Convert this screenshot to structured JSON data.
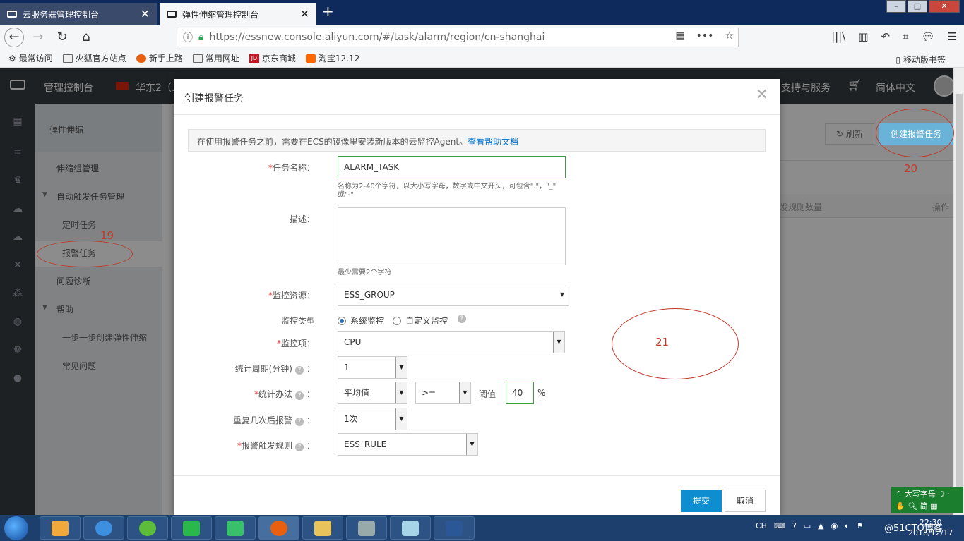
{
  "browser": {
    "tabs": [
      {
        "label": "云服务器管理控制台",
        "active": false
      },
      {
        "label": "弹性伸缩管理控制台",
        "active": true
      }
    ],
    "url": "https://essnew.console.aliyun.com/#/task/alarm/region/cn-shanghai",
    "bookmarks": [
      "最常访问",
      "火狐官方站点",
      "新手上路",
      "常用网址",
      "京东商城",
      "淘宝12.12"
    ],
    "mobile_bookmarks": "移动版书签"
  },
  "console": {
    "home": "管理控制台",
    "region": "华东2（...",
    "support": "支持与服务",
    "language": "简体中文"
  },
  "sidebar": {
    "title": "弹性伸缩",
    "items": {
      "group_mgmt": "伸缩组管理",
      "auto_tasks": "自动触发任务管理",
      "scheduled": "定时任务",
      "alarm": "报警任务",
      "diagnosis": "问题诊断",
      "help": "帮助",
      "step_by_step": "一步一步创建弹性伸缩",
      "faq": "常见问题"
    }
  },
  "main": {
    "refresh": "刷新",
    "create": "创建报警任务",
    "col_rules": "发规则数量",
    "col_ops": "操作"
  },
  "modal": {
    "title": "创建报警任务",
    "notice_text": "在使用报警任务之前，需要在ECS的镜像里安装新版本的云监控Agent。",
    "notice_link": "查看帮助文档",
    "task_name_label": "任务名称：",
    "task_name_value": "ALARM_TASK",
    "task_name_hint1": "名称为2-40个字符，以大小写字母，数字或中文开头，可包含\".\"，\"_\"",
    "task_name_hint2": "或\"-\"",
    "desc_label": "描述：",
    "desc_hint": "最少需要2个字符",
    "resource_label": "监控资源：",
    "resource_value": "ESS_GROUP",
    "type_label": "监控类型",
    "type_system": "系统监控",
    "type_custom": "自定义监控",
    "metric_label": "监控项：",
    "metric_value": "CPU",
    "period_label": "统计周期(分钟)",
    "period_value": "1",
    "method_label": "统计办法",
    "method_value": "平均值",
    "operator_value": ">=",
    "threshold_label": "阈值",
    "threshold_value": "40",
    "threshold_unit": "%",
    "repeat_label": "重复几次后报警",
    "repeat_value": "1次",
    "rule_label": "报警触发规则",
    "rule_value": "ESS_RULE",
    "submit": "提交",
    "cancel": "取消",
    "colon": "："
  },
  "annotations": {
    "n19": "19",
    "n20": "20",
    "n21": "21"
  },
  "taskbar": {
    "lang": "CH",
    "time": "22:30",
    "date": "2018/12/17"
  },
  "ime": {
    "line1": "大写字母",
    "line2": "简"
  },
  "watermark": "@51CTO博客",
  "colors": {
    "accent": "#0e8ed1",
    "required": "#e4393c",
    "annotation": "#c0392b",
    "console_dark": "#373d41"
  }
}
